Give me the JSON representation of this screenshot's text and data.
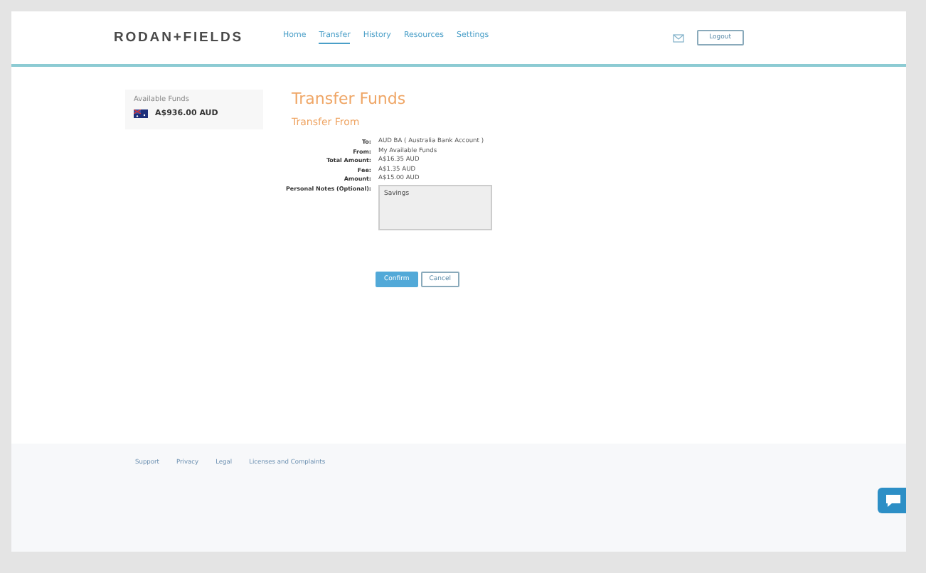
{
  "header": {
    "logo": "RODAN+FIELDS",
    "nav": [
      {
        "label": "Home",
        "selected": false
      },
      {
        "label": "Transfer",
        "selected": true
      },
      {
        "label": "History",
        "selected": false
      },
      {
        "label": "Resources",
        "selected": false
      },
      {
        "label": "Settings",
        "selected": false
      }
    ],
    "logout": "Logout"
  },
  "sidebar": {
    "title": "Available Funds",
    "balance": "A$936.00 AUD"
  },
  "content": {
    "title": "Transfer Funds",
    "subtitle": "Transfer From",
    "rows": [
      {
        "label": "To:",
        "value": "AUD BA ( Australia Bank Account )"
      },
      {
        "label": "From:",
        "value": "My Available Funds"
      },
      {
        "label": "Total Amount:",
        "value": "A$16.35 AUD"
      },
      {
        "label": "Fee:",
        "value": "A$1.35 AUD"
      },
      {
        "label": "Amount:",
        "value": "A$15.00 AUD"
      }
    ],
    "notes": {
      "label": "Personal Notes (Optional):",
      "value": "Savings"
    },
    "buttons": [
      {
        "label": "Confirm",
        "kind": "primary"
      },
      {
        "label": "Cancel",
        "kind": "secondary"
      }
    ]
  },
  "footer": {
    "links": [
      "Support",
      "Privacy",
      "Legal",
      "Licenses and Complaints"
    ]
  }
}
